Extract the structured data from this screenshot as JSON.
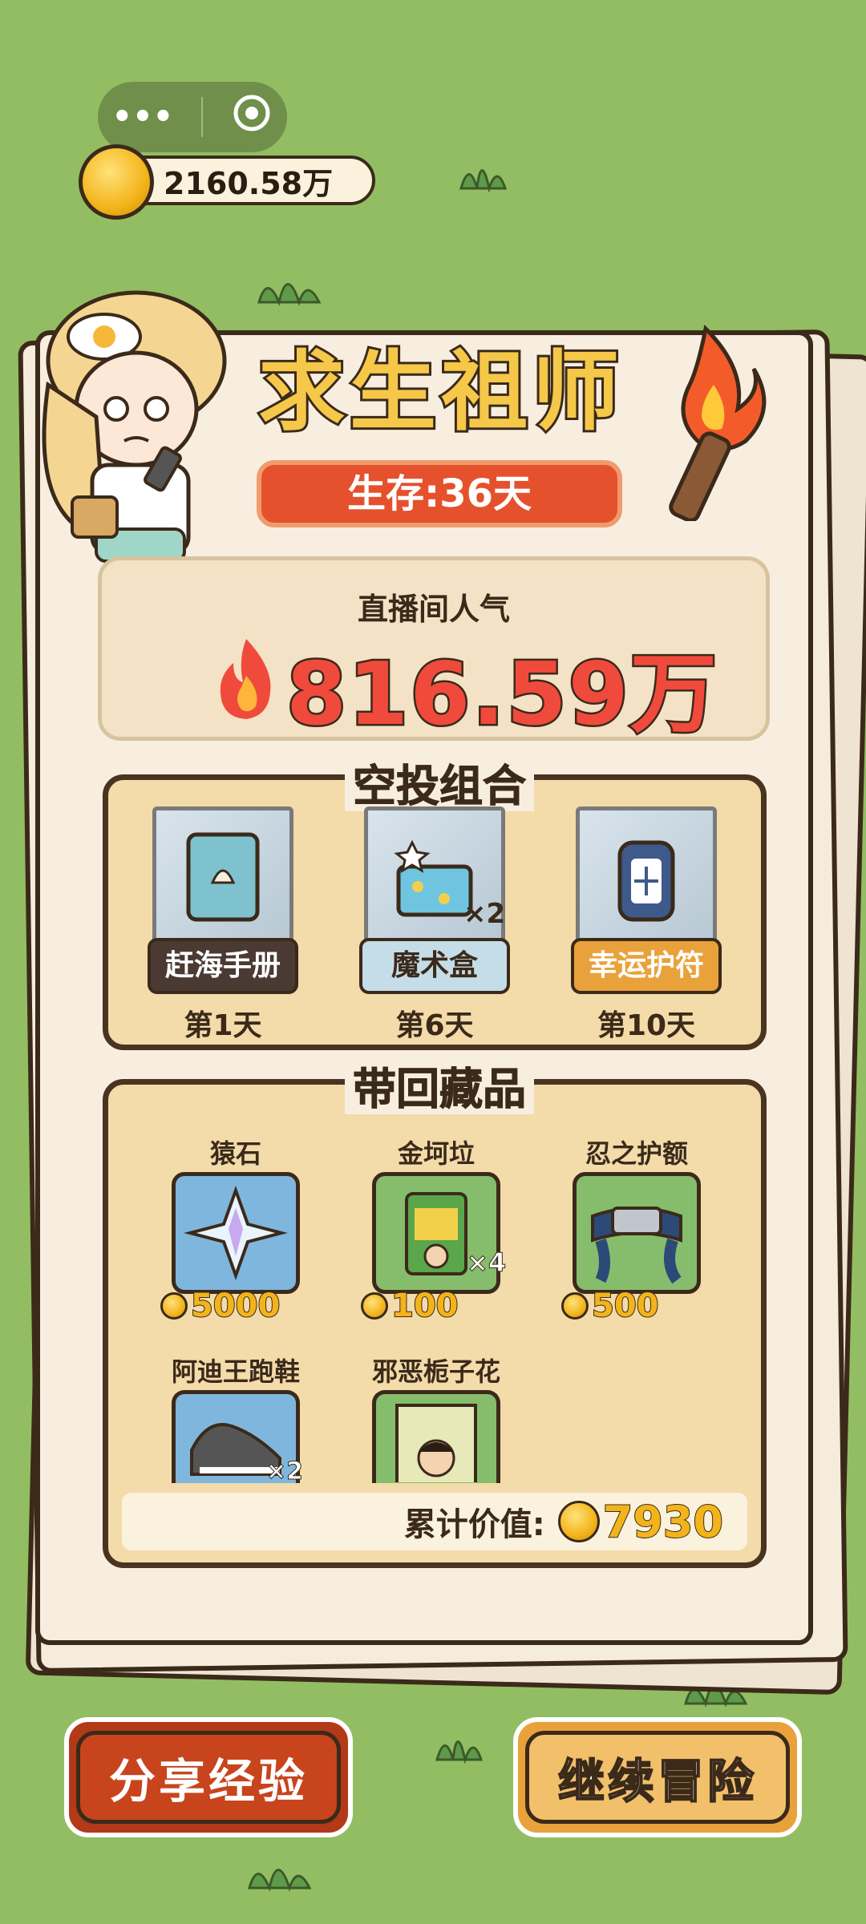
{
  "top": {
    "coin_balance": "2160.58万",
    "menu_icon": "more-dots-icon",
    "close_icon": "target-circle-icon"
  },
  "header": {
    "title": "求生祖师",
    "survive": "生存:36天"
  },
  "popularity": {
    "label": "直播间人气",
    "value": "816.59万"
  },
  "airdrop": {
    "title": "空投组合",
    "items": [
      {
        "name": "赶海手册",
        "day": "第1天",
        "count": "",
        "color": "#4a3a33"
      },
      {
        "name": "魔术盒",
        "day": "第6天",
        "count": "×2",
        "color": "#c5dde8"
      },
      {
        "name": "幸运护符",
        "day": "第10天",
        "count": "",
        "color": "#e9a23b"
      }
    ]
  },
  "collection": {
    "title": "带回藏品",
    "items": [
      {
        "name": "猿石",
        "price": "5000",
        "count": "",
        "color": "#7fb6de"
      },
      {
        "name": "金坷垃",
        "price": "100",
        "count": "×4",
        "color": "#86bd6c"
      },
      {
        "name": "忍之护额",
        "price": "500",
        "count": "",
        "color": "#86bd6c"
      },
      {
        "name": "阿迪王跑鞋",
        "price": "",
        "count": "×2",
        "color": "#7fb6de"
      },
      {
        "name": "邪恶栀子花",
        "price": "",
        "count": "",
        "color": "#86bd6c"
      }
    ],
    "total_label": "累计价值:",
    "total_value": "7930"
  },
  "buttons": {
    "share": "分享经验",
    "continue": "继续冒险"
  },
  "colors": {
    "background": "#93bd62",
    "accent_red": "#e5512d",
    "accent_gold": "#f3b41b"
  }
}
